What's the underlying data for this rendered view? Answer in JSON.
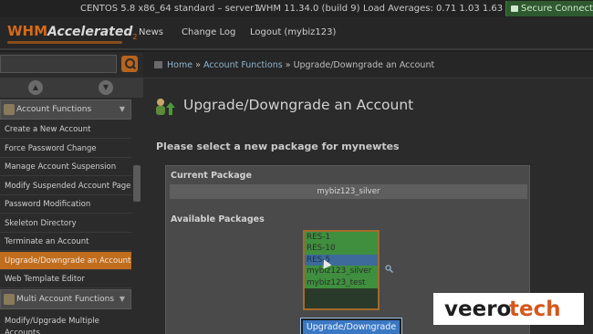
{
  "statusbar": {
    "system": "CENTOS 5.8 x86_64 standard – server1",
    "whm_version": "WHM 11.34.0 (build 9)",
    "load_averages": "Load Averages: 0.71 1.03 1.63",
    "secure": "Secure Connection"
  },
  "logo": {
    "brand": "WHM",
    "product": "Accelerated",
    "version": "2"
  },
  "nav": {
    "news": "News",
    "changelog": "Change Log",
    "logout": "Logout (mybiz123)"
  },
  "sidebar": {
    "category1": "Account Functions",
    "items": [
      "Create a New Account",
      "Force Password Change",
      "Manage Account Suspension",
      "Modify Suspended Account Page",
      "Password Modification",
      "Skeleton Directory",
      "Terminate an Account",
      "Upgrade/Downgrade an Account",
      "Web Template Editor"
    ],
    "active_index": 7,
    "category2": "Multi Account Functions",
    "items2": [
      "Modify/Upgrade Multiple",
      "Accounts"
    ]
  },
  "breadcrumb": {
    "home": "Home",
    "sep": "»",
    "section": "Account Functions",
    "current": "Upgrade/Downgrade an Account"
  },
  "page": {
    "title": "Upgrade/Downgrade an Account",
    "subtitle": "Please select a new package for mynewtes",
    "current_label": "Current Package",
    "current_value": "mybiz123_silver",
    "available_label": "Available Packages",
    "packages": [
      "RES-1",
      "RES-10",
      "RES-5",
      "mybiz123_silver",
      "mybiz123_test"
    ],
    "selected_package": "RES-5",
    "submit_label": "Upgrade/Downgrade"
  },
  "watermark": {
    "text": "veerotech"
  },
  "colors": {
    "accent": "#c06d1e",
    "package_bg": "#3f8f3f",
    "selected_bg": "#3d6a9a",
    "button": "#3a78c4"
  }
}
